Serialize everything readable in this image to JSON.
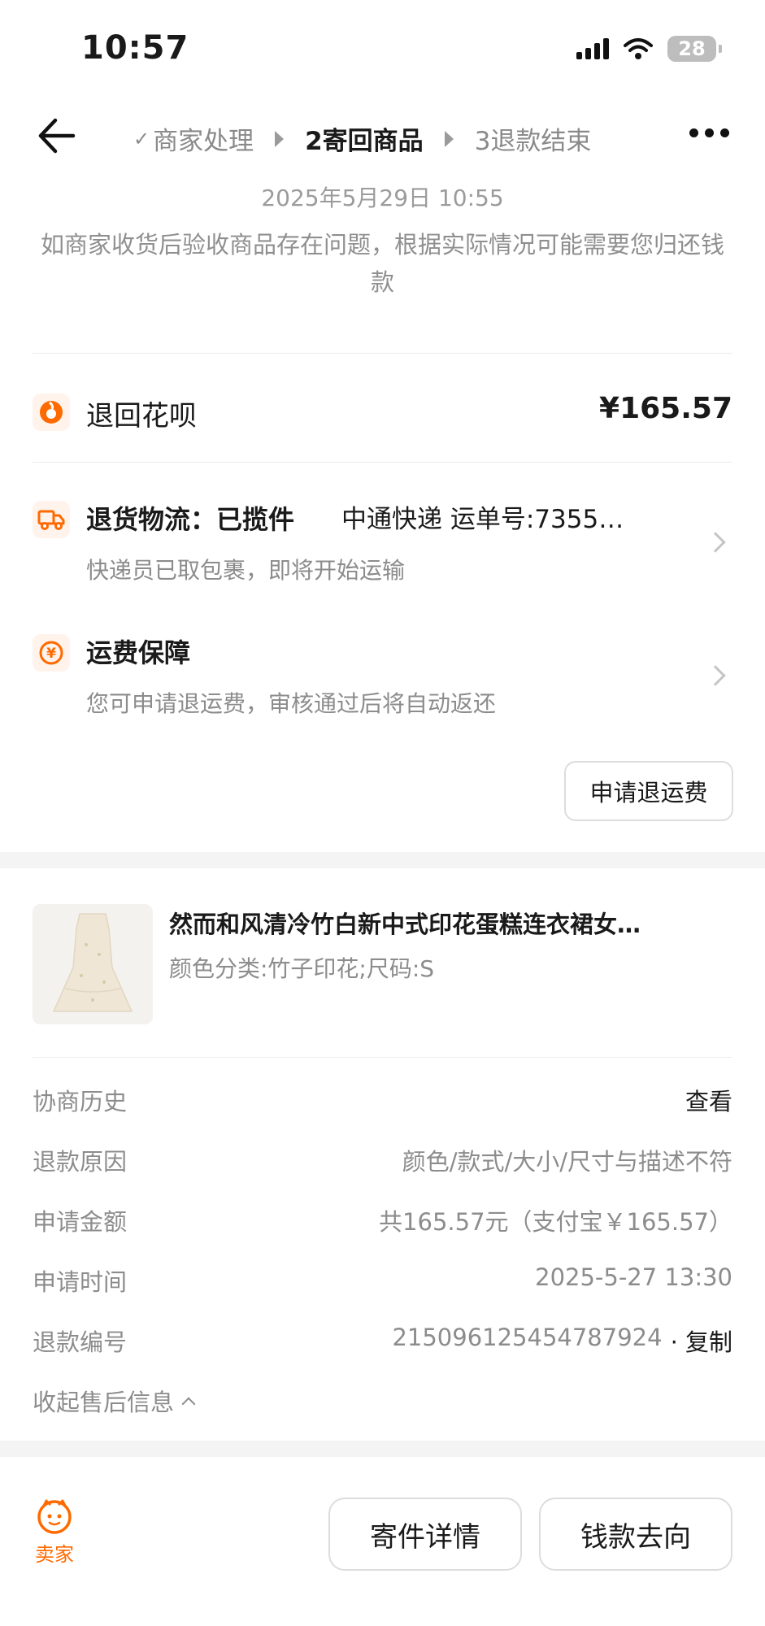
{
  "status_bar": {
    "time": "10:57",
    "battery": "28"
  },
  "nav": {
    "steps": [
      {
        "label": "商家处理",
        "prefix": "✓"
      },
      {
        "label": "2寄回商品"
      },
      {
        "label": "3退款结束"
      }
    ]
  },
  "header": {
    "date": "2025年5月29日 10:55",
    "notice": "如商家收货后验收商品存在问题，根据实际情况可能需要您归还钱款"
  },
  "refund": {
    "method": "退回花呗",
    "amount": "¥165.57"
  },
  "logistics": {
    "title": "退货物流：已揽件",
    "carrier_info": "中通快递 运单号:7355…",
    "desc": "快递员已取包裹，即将开始运输"
  },
  "shipping_guarantee": {
    "title": "运费保障",
    "desc": "您可申请退运费，审核通过后将自动返还",
    "button": "申请退运费"
  },
  "product": {
    "title": "然而和风清冷竹白新中式印花蛋糕连衣裙女…",
    "spec": "颜色分类:竹子印花;尺码:S"
  },
  "details": [
    {
      "label": "协商历史",
      "value": "查看"
    },
    {
      "label": "退款原因",
      "value": "颜色/款式/大小/尺寸与描述不符"
    },
    {
      "label": "申请金额",
      "value": "共165.57元（支付宝￥165.57）"
    },
    {
      "label": "申请时间",
      "value": "2025-5-27 13:30"
    },
    {
      "label": "退款编号",
      "value": "215096125454787924",
      "action": "· 复制"
    }
  ],
  "collapse_label": "收起售后信息",
  "bottom": {
    "seller_label": "卖家",
    "buttons": [
      "寄件详情",
      "钱款去向"
    ]
  },
  "colors": {
    "accent": "#ff6a00",
    "text": "#1a1a1a",
    "muted": "#8c8c8c"
  }
}
